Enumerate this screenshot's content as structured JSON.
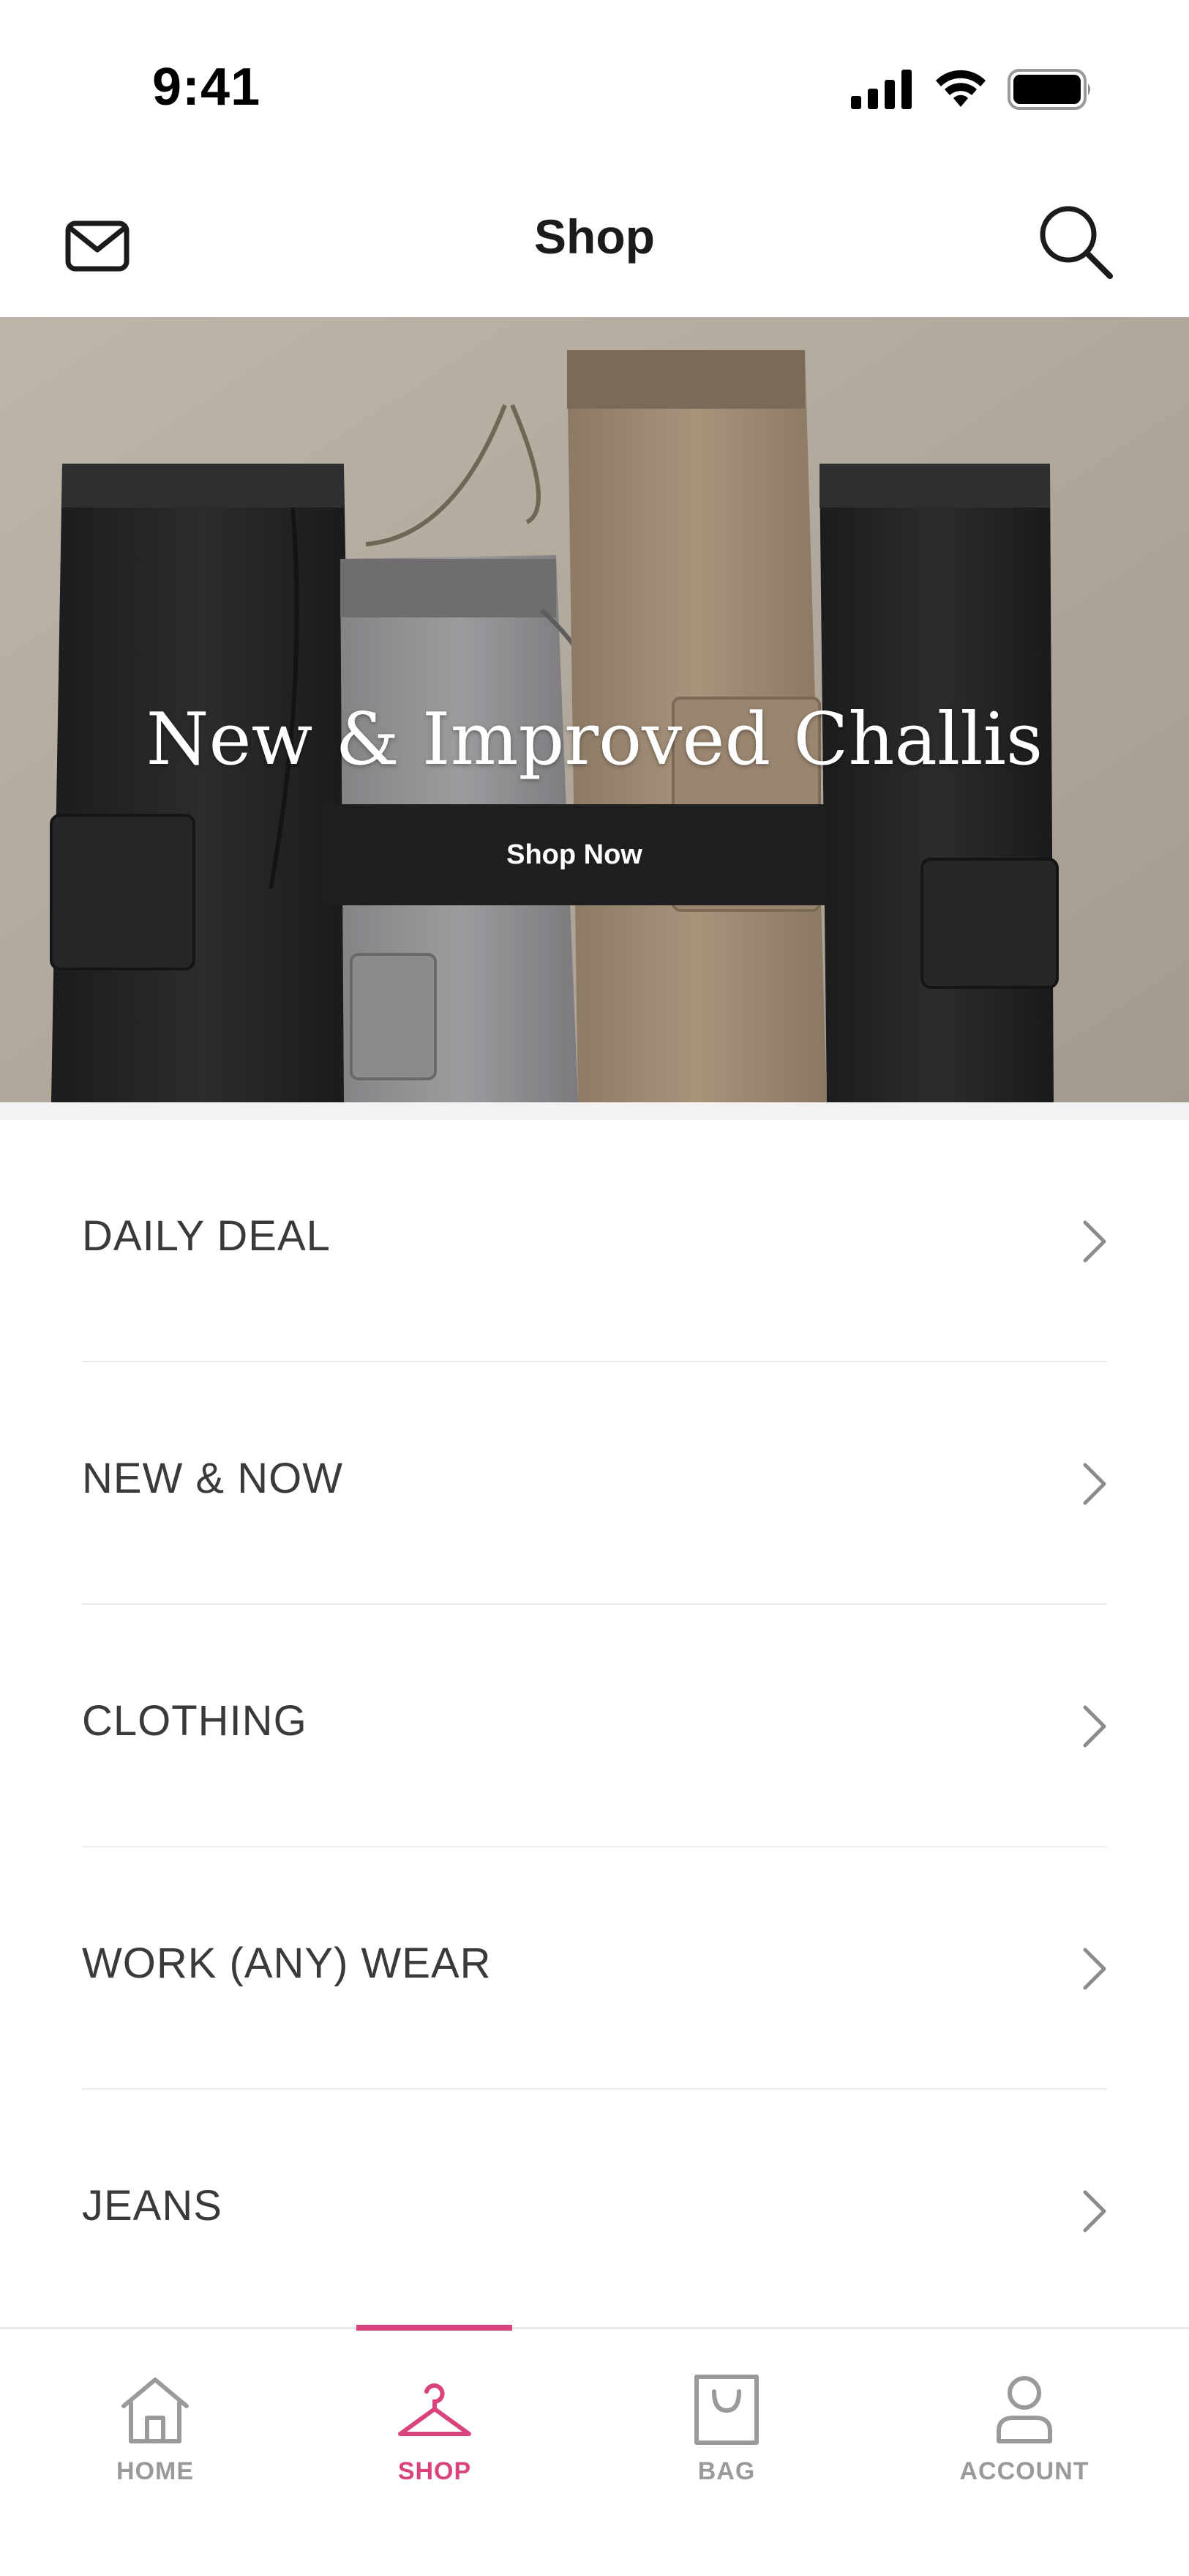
{
  "status_bar": {
    "time": "9:41"
  },
  "header": {
    "title": "Shop",
    "icons": {
      "left": "mail-icon",
      "right": "search-icon"
    }
  },
  "hero": {
    "title": "New & Improved Challis",
    "cta_label": "Shop Now"
  },
  "menu": {
    "items": [
      {
        "label": "DAILY DEAL"
      },
      {
        "label": "NEW & NOW"
      },
      {
        "label": "CLOTHING"
      },
      {
        "label": "WORK (ANY) WEAR"
      },
      {
        "label": "JEANS"
      }
    ]
  },
  "tab_bar": {
    "tabs": [
      {
        "label": "HOME",
        "icon": "home-icon",
        "active": false
      },
      {
        "label": "SHOP",
        "icon": "hanger-icon",
        "active": true
      },
      {
        "label": "BAG",
        "icon": "bag-icon",
        "active": false
      },
      {
        "label": "ACCOUNT",
        "icon": "account-icon",
        "active": false
      }
    ]
  },
  "colors": {
    "accent": "#d9447e",
    "text_primary": "#1b1b1b",
    "inactive": "#9a9a9a",
    "cta_background": "#1f1f1f"
  }
}
